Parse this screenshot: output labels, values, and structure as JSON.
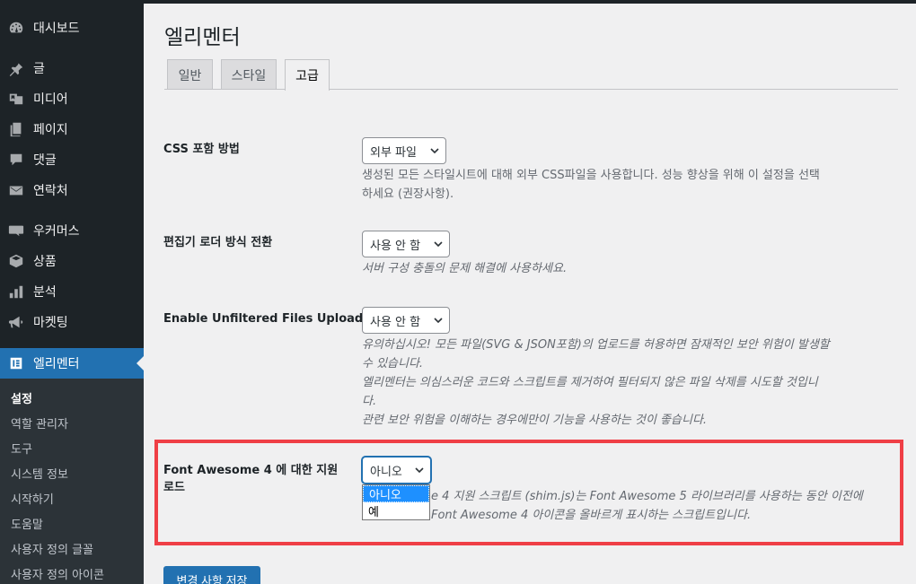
{
  "sidebar": {
    "items": [
      {
        "label": "대시보드",
        "icon": "dashboard-icon"
      },
      {
        "label": "글",
        "icon": "pin-icon"
      },
      {
        "label": "미디어",
        "icon": "media-icon"
      },
      {
        "label": "페이지",
        "icon": "page-icon"
      },
      {
        "label": "댓글",
        "icon": "comment-icon"
      },
      {
        "label": "연락처",
        "icon": "mail-icon"
      },
      {
        "label": "우커머스",
        "icon": "woo-icon"
      },
      {
        "label": "상품",
        "icon": "box-icon"
      },
      {
        "label": "분석",
        "icon": "bar-chart-icon"
      },
      {
        "label": "마켓팅",
        "icon": "megaphone-icon"
      },
      {
        "label": "엘리멘터",
        "icon": "elementor-icon"
      }
    ],
    "submenu": [
      "설정",
      "역할 관리자",
      "도구",
      "시스템 정보",
      "시작하기",
      "도움말",
      "사용자 정의 글꼴",
      "사용자 정의 아이콘"
    ]
  },
  "page": {
    "title": "엘리멘터",
    "tabs": [
      "일반",
      "스타일",
      "고급"
    ],
    "active_tab": "고급"
  },
  "settings": {
    "css": {
      "label": "CSS 포함 방법",
      "value": "외부 파일",
      "desc1": "생성된 모든 스타일시트에 대해 외부 CSS파일을 사용합니다. 성능 향상을 위해 이 설정을 선택",
      "desc2": "하세요 (권장사항)."
    },
    "loader": {
      "label": "편집기 로더 방식 전환",
      "value": "사용 안 함",
      "desc": "서버 구성 충돌의 문제 해결에 사용하세요."
    },
    "unfiltered": {
      "label": "Enable Unfiltered Files Uploads",
      "value": "사용 안 함",
      "desc1": "유의하십시오! 모든 파일(SVG & JSON포함)의 업로드를 허용하면 잠재적인 보안 위험이 발생할",
      "desc2": "수 있습니다.",
      "desc3": "엘리멘터는 의심스러운 코드와 스크립트를 제거하여 필터되지 않은 파일 삭제를 시도할 것입니",
      "desc4": "다.",
      "desc5": "관련 보안 위험을 이해하는 경우에만이 기능을 사용하는 것이 좋습니다."
    },
    "fontawesome": {
      "label1": "Font Awesome 4 에 대한 지원",
      "label2": "로드",
      "value": "아니오",
      "options": [
        "아니오",
        "예"
      ],
      "desc1": "e 4 지원 스크립트 (shim.js)는 Font Awesome 5 라이브러리를 사용하는 동안 이전에",
      "desc2": "Font Awesome 4 아이콘을 올바르게 표시하는 스크립트입니다."
    }
  },
  "save_label": "변경 사항 저장"
}
